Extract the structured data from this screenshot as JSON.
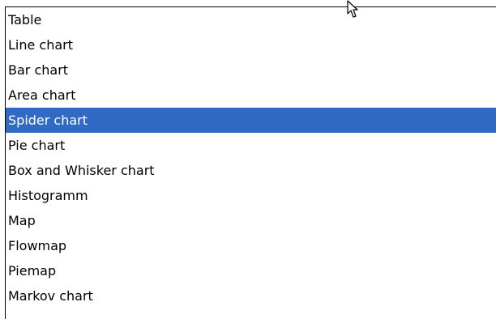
{
  "list": {
    "items": [
      {
        "label": "Table"
      },
      {
        "label": "Line chart"
      },
      {
        "label": "Bar chart"
      },
      {
        "label": "Area chart"
      },
      {
        "label": "Spider chart"
      },
      {
        "label": "Pie chart"
      },
      {
        "label": "Box and Whisker chart"
      },
      {
        "label": "Histogramm"
      },
      {
        "label": "Map"
      },
      {
        "label": "Flowmap"
      },
      {
        "label": "Piemap"
      },
      {
        "label": "Markov chart"
      }
    ],
    "selected_index": 4
  },
  "colors": {
    "selection_background": "#316ac5",
    "selection_text": "#ffffff",
    "text": "#000000",
    "background": "#ffffff"
  },
  "icons": {
    "cursor": "mouse-pointer-icon"
  }
}
